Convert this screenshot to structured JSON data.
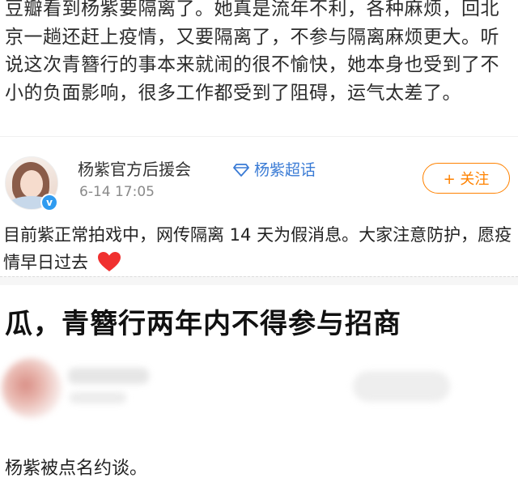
{
  "top_post": {
    "text": "豆瓣看到杨紫要隔离了。她真是流年不利，各种麻烦，回北京一趟还赶上疫情，又要隔离了，不参与隔离麻烦更大。听说这次青簪行的事本来就闹的很不愉快，她本身也受到了不小的负面影响，很多工作都受到了阻碍，运气太差了。"
  },
  "weibo_post": {
    "author": "杨紫官方后援会",
    "super_topic": "杨紫超话",
    "time": "6-14 17:05",
    "follow_label": "+ 关注",
    "verified_badge": "v",
    "body": "目前紫正常拍戏中，网传隔离 14 天为假消息。大家注意防护，愿疫情早日过去",
    "icons": {
      "topic": "diamond-icon",
      "emoji": "red-heart-icon"
    }
  },
  "headline_post": {
    "headline": "瓜，青簪行两年内不得参与招商",
    "subtext": "杨紫被点名约谈。"
  },
  "colors": {
    "follow_accent": "#ff8200",
    "topic_blue": "#3a7bd5",
    "verified_blue": "#2f9bf0"
  }
}
